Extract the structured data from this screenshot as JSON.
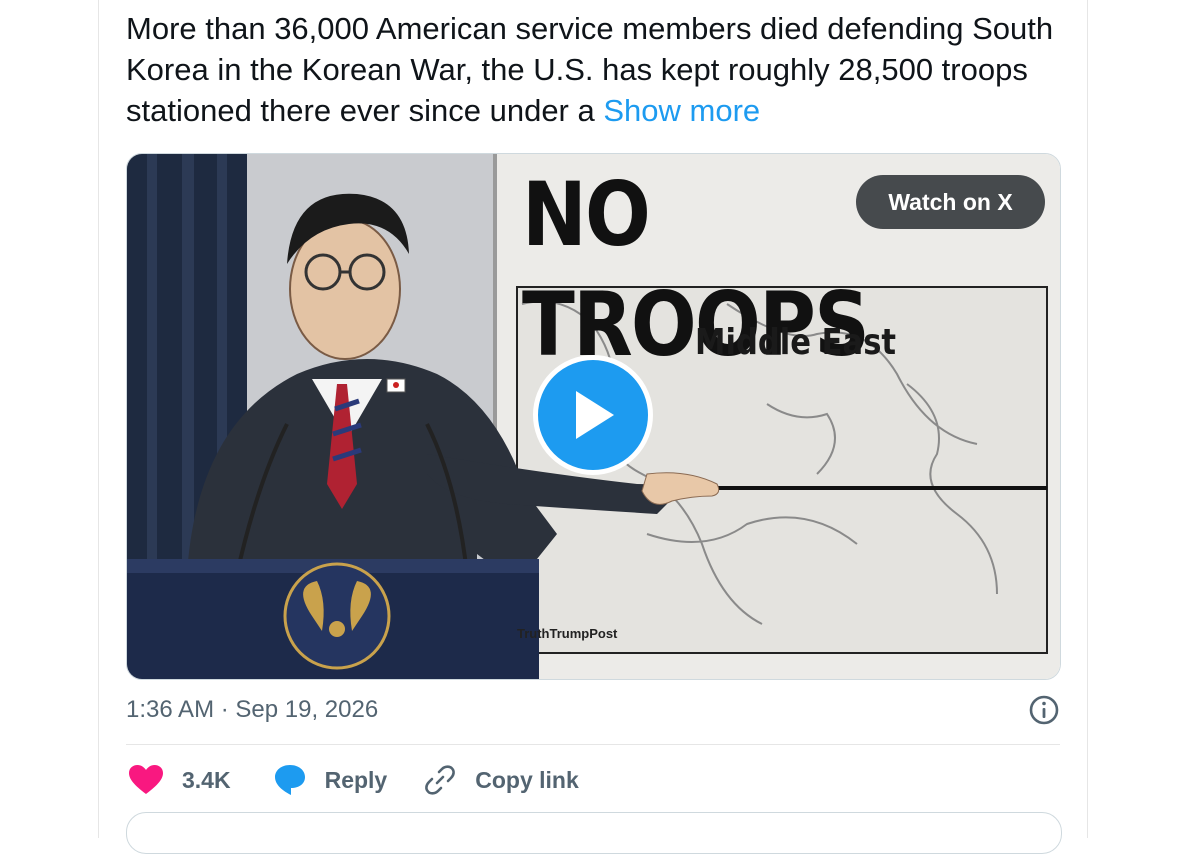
{
  "tweet": {
    "text": "More than 36,000 American service members died defending South Korea in the Korean War, the U.S. has kept roughly 28,500 troops stationed there ever since under a ",
    "show_more": "Show more"
  },
  "media": {
    "headline": "NO TROOPS",
    "map_label": "Middle East",
    "watermark": "TruthTrumpPost",
    "watch_label": "Watch on X"
  },
  "meta": {
    "timestamp": "1:36 AM · Sep 19, 2026",
    "info_icon": "info-icon"
  },
  "actions": {
    "likes": "3.4K",
    "reply": "Reply",
    "copy_link": "Copy link"
  },
  "colors": {
    "accent": "#1d9bf0",
    "like": "#f91880",
    "muted": "#536471",
    "text": "#0f1419"
  }
}
